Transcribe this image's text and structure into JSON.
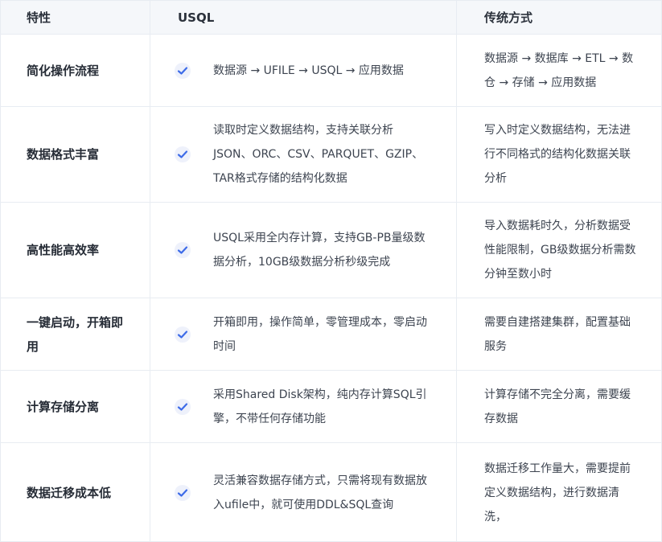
{
  "header": {
    "col1": "特性",
    "col2": "USQL",
    "col3": "传统方式"
  },
  "rows": [
    {
      "feature": "简化操作流程",
      "usql": "数据源 → UFILE → USQL → 应用数据",
      "traditional": "数据源 → 数据库 → ETL → 数仓 → 存储 → 应用数据"
    },
    {
      "feature": "数据格式丰富",
      "usql": "读取时定义数据结构，支持关联分析JSON、ORC、CSV、PARQUET、GZIP、TAR格式存储的结构化数据",
      "traditional": "写入时定义数据结构，无法进行不同格式的结构化数据关联分析"
    },
    {
      "feature": "高性能高效率",
      "usql": "USQL采用全内存计算，支持GB-PB量级数据分析，10GB级数据分析秒级完成",
      "traditional": "导入数据耗时久，分析数据受性能限制，GB级数据分析需数分钟至数小时"
    },
    {
      "feature": "一键启动，开箱即用",
      "usql": "开箱即用，操作简单，零管理成本，零启动时间",
      "traditional": "需要自建搭建集群，配置基础服务"
    },
    {
      "feature": "计算存储分离",
      "usql": "采用Shared Disk架构，纯内存计算SQL引擎，不带任何存储功能",
      "traditional": "计算存储不完全分离，需要缓存数据"
    },
    {
      "feature": "数据迁移成本低",
      "usql": "灵活兼容数据存储方式，只需将现有数据放入ufile中，就可使用DDL&SQL查询",
      "traditional": "数据迁移工作量大，需要提前定义数据结构，进行数据清洗，"
    }
  ],
  "check_icon": "checkmark-icon",
  "colors": {
    "check": "#3d6be8",
    "border": "#e8ecf2",
    "header_bg": "#f5f7fa"
  }
}
